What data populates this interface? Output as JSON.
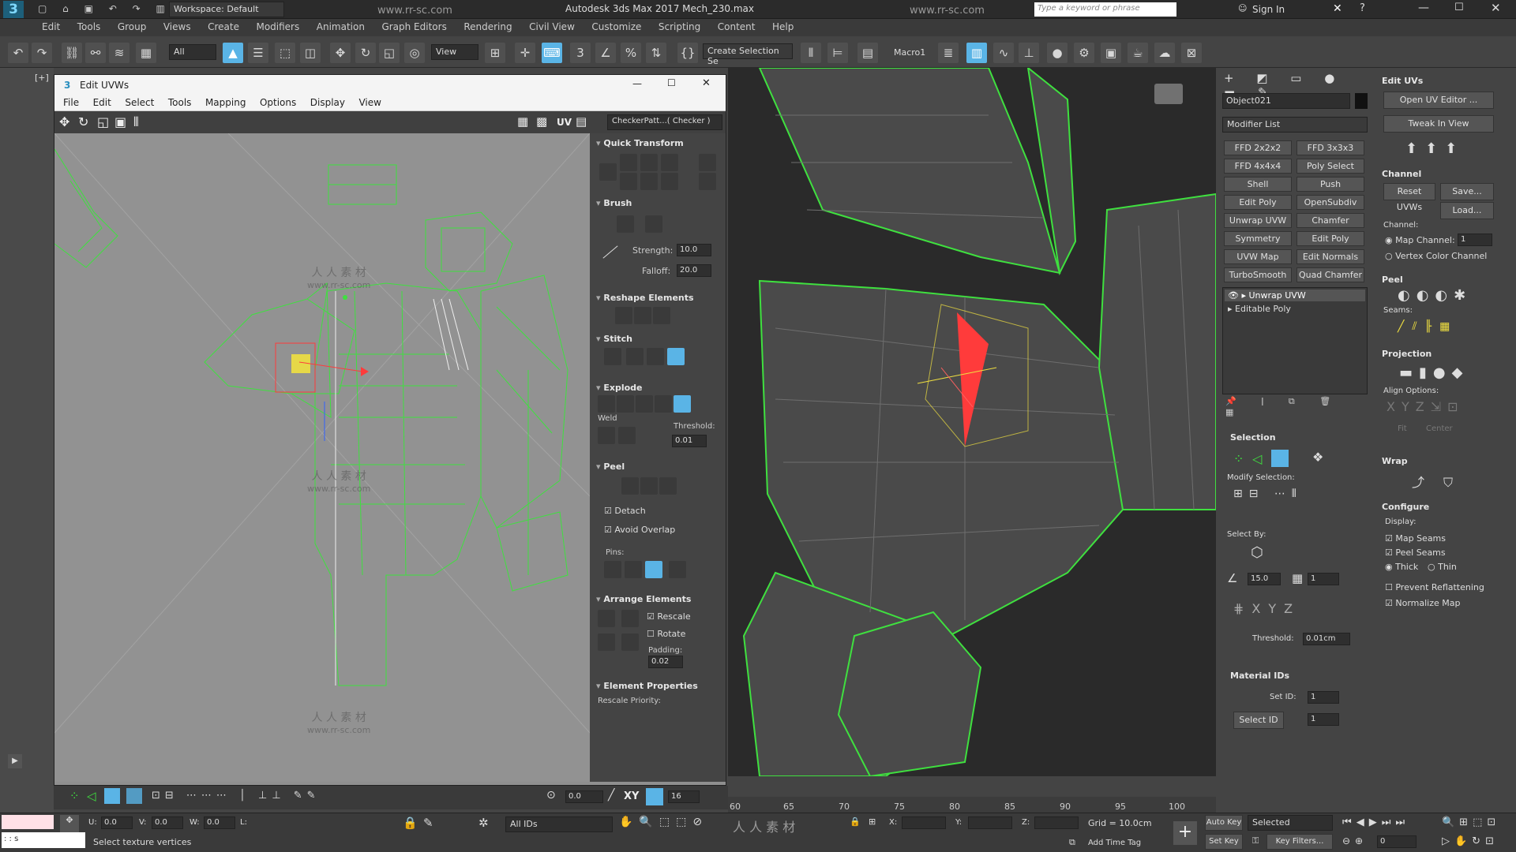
{
  "app": {
    "title": "Autodesk 3ds Max 2017    Mech_230.max",
    "workspace": "Workspace: Default",
    "search_placeholder": "Type a keyword or phrase",
    "signin": "Sign In",
    "watermark_url": "www.rr-sc.com",
    "watermark_cn": "人 人 素 材"
  },
  "menu": [
    "Edit",
    "Tools",
    "Group",
    "Views",
    "Create",
    "Modifiers",
    "Animation",
    "Graph Editors",
    "Rendering",
    "Civil View",
    "Customize",
    "Scripting",
    "Content",
    "Help"
  ],
  "toolbar": {
    "filter": "All",
    "view": "View",
    "selection_set": "Create Selection Se",
    "macro": "Macro1"
  },
  "viewport_label": "[+]",
  "uv_editor": {
    "title": "Edit UVWs",
    "menu": [
      "File",
      "Edit",
      "Select",
      "Tools",
      "Mapping",
      "Options",
      "Display",
      "View"
    ],
    "uv_label": "UV",
    "checker": "CheckerPatt...( Checker )",
    "sections": {
      "quick_transform": "Quick Transform",
      "brush": "Brush",
      "strength_label": "Strength:",
      "strength": "10.0",
      "falloff_label": "Falloff:",
      "falloff": "20.0",
      "reshape": "Reshape Elements",
      "stitch": "Stitch",
      "explode": "Explode",
      "weld": "Weld",
      "threshold_label": "Threshold:",
      "threshold": "0.01",
      "peel": "Peel",
      "detach": "Detach",
      "avoid_overlap": "Avoid Overlap",
      "pins": "Pins:",
      "arrange": "Arrange Elements",
      "rescale": "Rescale",
      "rotate": "Rotate",
      "padding_label": "Padding:",
      "padding": "0.02",
      "element_props": "Element Properties",
      "rescale_priority": "Rescale Priority:"
    },
    "bottom": {
      "value": "0.0",
      "xy": "XY",
      "count": "16",
      "u_label": "U:",
      "u": "0.0",
      "v_label": "V:",
      "v": "0.0",
      "w_label": "W:",
      "w": "0.0",
      "l_label": "L:",
      "ids": "All IDs"
    }
  },
  "command_panel": {
    "object_name": "Object021",
    "modifier_list": "Modifier List",
    "modifier_buttons": [
      "FFD 2x2x2",
      "FFD 3x3x3",
      "FFD 4x4x4",
      "Poly Select",
      "Shell",
      "Push",
      "Edit Poly",
      "OpenSubdiv",
      "Unwrap UVW",
      "Chamfer",
      "Symmetry",
      "Edit Poly",
      "UVW Map",
      "Edit Normals",
      "TurboSmooth",
      "Quad Chamfer"
    ],
    "stack": [
      "Unwrap UVW",
      "Editable Poly"
    ],
    "selection": "Selection",
    "modify_selection": "Modify Selection:",
    "select_by": "Select By:",
    "angle": "15.0",
    "count": "1",
    "threshold_label": "Threshold:",
    "threshold": "0.01cm",
    "material_ids": "Material IDs",
    "set_id_label": "Set ID:",
    "set_id": "1",
    "select_id": "Select ID",
    "select_id_val": "1"
  },
  "right_panel": {
    "edit_uvs": "Edit UVs",
    "open_uv_editor": "Open UV Editor ...",
    "tweak_in_view": "Tweak In View",
    "channel": "Channel",
    "reset_uvws": "Reset UVWs",
    "save": "Save...",
    "load": "Load...",
    "channel_label": "Channel:",
    "map_channel": "Map Channel:",
    "map_channel_val": "1",
    "vertex_color_channel": "Vertex Color Channel",
    "peel": "Peel",
    "seams": "Seams:",
    "projection": "Projection",
    "align_options": "Align Options:",
    "fit": "Fit",
    "center": "Center",
    "wrap": "Wrap",
    "configure": "Configure",
    "display": "Display:",
    "map_seams": "Map Seams",
    "peel_seams": "Peel Seams",
    "thick": "Thick",
    "thin": "Thin",
    "prevent_reflattening": "Prevent Reflattening",
    "normalize_map": "Normalize Map"
  },
  "timeline": {
    "ticks": [
      "60",
      "65",
      "70",
      "75",
      "80",
      "85",
      "90",
      "95",
      "100"
    ]
  },
  "status": {
    "prompt": "Select texture vertices",
    "x_label": "X:",
    "y_label": "Y:",
    "z_label": "Z:",
    "grid": "Grid = 10.0cm",
    "add_time_tag": "Add Time Tag",
    "auto_key": "Auto Key",
    "set_key": "Set Key",
    "selected": "Selected",
    "key_filters": "Key Filters...",
    "frame": "0"
  },
  "colors": {
    "wire_green": "#3fe03f",
    "selection_red": "#ff3b3b",
    "highlight_yellow": "#f0e040",
    "active_blue": "#5ab4e6"
  }
}
